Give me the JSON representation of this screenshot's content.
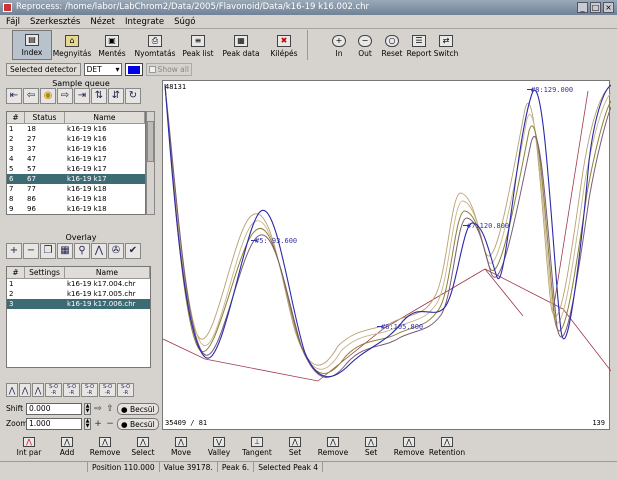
{
  "window": {
    "title": "Reprocess: /home/labor/LabChrom2/Data/2005/Flavonoid/Data/k16-19 k16.002.chr"
  },
  "menu": [
    "Fájl",
    "Szerkesztés",
    "Nézet",
    "Integrate",
    "Súgó"
  ],
  "toolbar": {
    "main": [
      {
        "label": "Index",
        "icon": "index-icon"
      },
      {
        "label": "Megnyitás",
        "icon": "folder-open-icon"
      },
      {
        "label": "Mentés",
        "icon": "save-icon"
      },
      {
        "label": "Nyomtatás",
        "icon": "print-icon"
      },
      {
        "label": "Peak list",
        "icon": "peak-list-icon"
      },
      {
        "label": "Peak data",
        "icon": "peak-data-icon"
      },
      {
        "label": "Kilépés",
        "icon": "exit-icon"
      }
    ],
    "zoom": [
      {
        "label": "In",
        "icon": "zoom-in-icon"
      },
      {
        "label": "Out",
        "icon": "zoom-out-icon"
      },
      {
        "label": "Reset",
        "icon": "zoom-reset-icon"
      },
      {
        "label": "Report",
        "icon": "report-icon"
      },
      {
        "label": "Switch",
        "icon": "switch-icon"
      }
    ]
  },
  "detector": {
    "label": "Selected detector",
    "value": "DET",
    "color": "#0000e6",
    "show_all": "Show all"
  },
  "sample_queue": {
    "title": "Sample queue",
    "headers": [
      "#",
      "Status",
      "Name"
    ],
    "rows": [
      {
        "n": "1",
        "status": "18",
        "name": "k16-19 k16"
      },
      {
        "n": "2",
        "status": "27",
        "name": "k16-19 k16"
      },
      {
        "n": "3",
        "status": "37",
        "name": "k16-19 k16"
      },
      {
        "n": "4",
        "status": "47",
        "name": "k16-19 k17"
      },
      {
        "n": "5",
        "status": "57",
        "name": "k16-19 k17"
      },
      {
        "n": "6",
        "status": "67",
        "name": "k16-19 k17"
      },
      {
        "n": "7",
        "status": "77",
        "name": "k16-19 k18"
      },
      {
        "n": "8",
        "status": "86",
        "name": "k16-19 k18"
      },
      {
        "n": "9",
        "status": "96",
        "name": "k16-19 k18"
      }
    ],
    "selected": 5
  },
  "overlay": {
    "title": "Overlay",
    "headers": [
      "#",
      "Settings",
      "Name"
    ],
    "rows": [
      {
        "n": "1",
        "settings": "",
        "name": "k16-19 k17.004.chr"
      },
      {
        "n": "2",
        "settings": "",
        "name": "k16-19 k17.005.chr"
      },
      {
        "n": "3",
        "settings": "",
        "name": "k16-19 k17.006.chr"
      }
    ],
    "selected": 2
  },
  "controls": {
    "shift_label": "Shift",
    "shift_value": "0.000",
    "zoom_label": "Zoom",
    "zoom_value": "1.000",
    "becsul": "Becsül"
  },
  "plot": {
    "y_top_label": "48131",
    "bottom_left_label": "35409 / 81",
    "bottom_right_label": "139",
    "peaks": [
      {
        "label": "#5: 93.600"
      },
      {
        "label": "#6:105.800"
      },
      {
        "label": "#7:120.800"
      },
      {
        "label": "#8:129.000"
      }
    ]
  },
  "bottom_toolbar": [
    {
      "label": "Int par",
      "icon": "int-par-icon"
    },
    {
      "label": "Add",
      "icon": "add-peak-icon"
    },
    {
      "label": "Remove",
      "icon": "remove-peak-icon"
    },
    {
      "label": "Select",
      "icon": "select-peak-icon"
    },
    {
      "label": "Move",
      "icon": "move-peak-icon"
    },
    {
      "label": "Valley",
      "icon": "valley-icon"
    },
    {
      "label": "Tangent",
      "icon": "tangent-icon"
    },
    {
      "label": "Set",
      "icon": "set-baseline-icon"
    },
    {
      "label": "Remove",
      "icon": "remove-baseline-icon"
    },
    {
      "label": "Set",
      "icon": "set-marker-icon"
    },
    {
      "label": "Remove",
      "icon": "remove-marker-icon"
    },
    {
      "label": "Retention",
      "icon": "retention-icon"
    }
  ],
  "status": {
    "position": "Position  110.000",
    "value": "Value  39178.",
    "peak": "Peak 6.",
    "selected_peak": "Selected Peak 4"
  }
}
